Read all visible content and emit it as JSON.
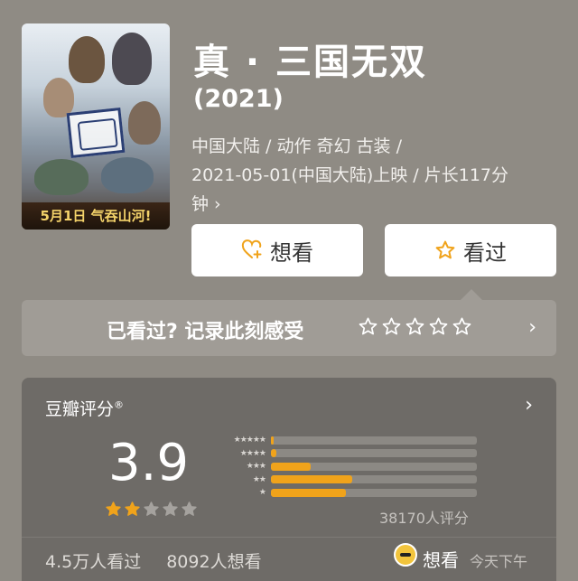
{
  "movie": {
    "title": "真 · 三国无双",
    "year": "(2021)",
    "meta_line1": "中国大陆 / 动作 奇幻 古装 /",
    "meta_line2": "2021-05-01(中国大陆)上映 / 片长117分",
    "meta_line3": "钟",
    "poster_tagline": "5月1日 气吞山河!"
  },
  "actions": {
    "want_label": "想看",
    "seen_label": "看过"
  },
  "rate_prompt": {
    "label": "已看过? 记录此刻感受",
    "star_count": 5
  },
  "rating": {
    "header": "豆瓣评分",
    "header_mark": "®",
    "score": "3.9",
    "score_stars": 2,
    "score_stars_max": 5,
    "distribution": [
      {
        "stars": 5,
        "percent": 1.2
      },
      {
        "stars": 4,
        "percent": 2.6
      },
      {
        "stars": 3,
        "percent": 19.5
      },
      {
        "stars": 2,
        "percent": 40.0
      },
      {
        "stars": 1,
        "percent": 36.7
      }
    ],
    "count_label": "38170人评分"
  },
  "footer": {
    "watched": "4.5万人看过",
    "wants": "8092人想看",
    "friend_action": "想看",
    "friend_time": "今天下午"
  },
  "colors": {
    "background": "#8f8b84",
    "card": "#6e6b67",
    "accent_star": "#f0a31b",
    "heart_icon": "#f0a31b"
  }
}
